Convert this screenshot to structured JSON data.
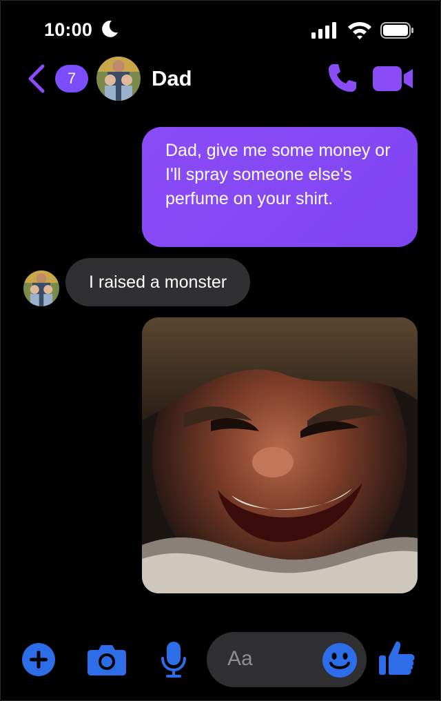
{
  "status_bar": {
    "time": "10:00",
    "icons": [
      "moon-icon",
      "signal-icon",
      "wifi-icon",
      "battery-icon"
    ]
  },
  "header": {
    "back_icon": "chevron-left-icon",
    "unread_count": "7",
    "contact_name": "Dad",
    "actions": [
      "phone-icon",
      "video-camera-icon"
    ]
  },
  "messages": [
    {
      "direction": "outgoing",
      "text": "Dad, give me some money or I'll spray someone else's perfume on your shirt."
    },
    {
      "direction": "incoming",
      "text": "I raised a monster"
    },
    {
      "direction": "outgoing",
      "type": "image",
      "content": "photo-of-laughing-boy"
    }
  ],
  "composer": {
    "placeholder": "Aa",
    "buttons": [
      "plus-icon",
      "camera-icon",
      "microphone-icon",
      "emoji-icon",
      "thumbs-up-icon"
    ]
  },
  "colors": {
    "accent": "#8a4cf7",
    "composer_blue": "#2e6de8",
    "incoming_bubble": "#303033",
    "background": "#000000"
  }
}
